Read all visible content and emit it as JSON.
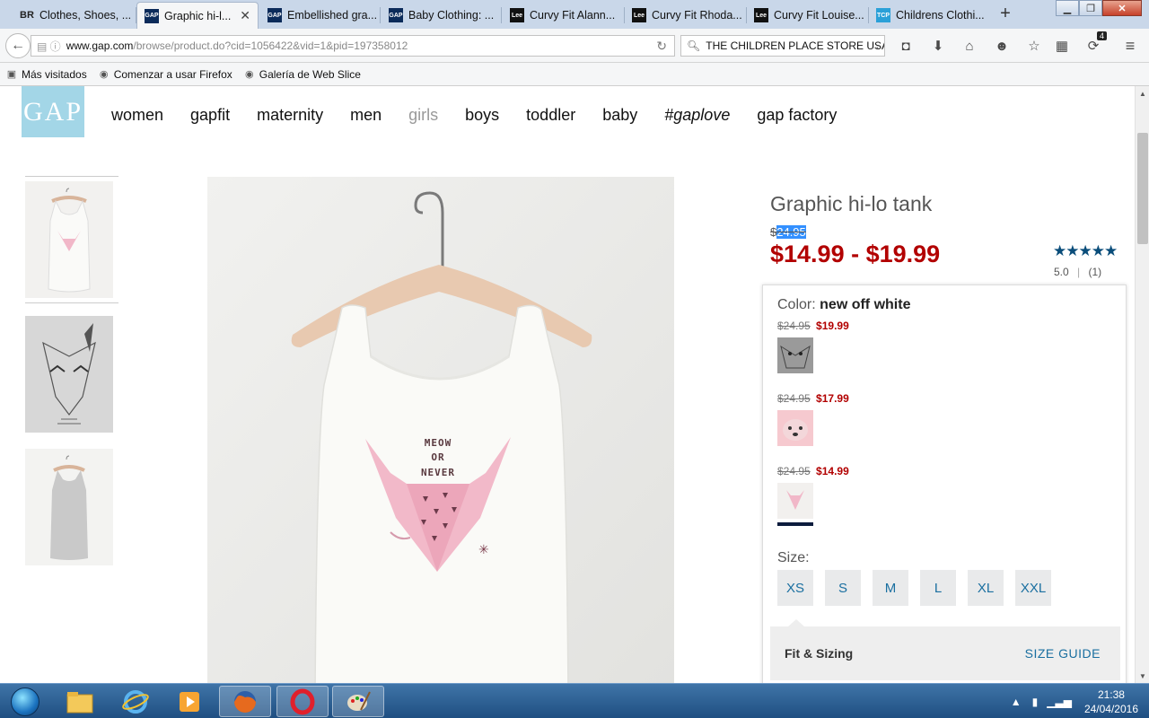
{
  "browser": {
    "tabs": [
      {
        "label": "Clothes, Shoes, ...",
        "favicon": "BR"
      },
      {
        "label": "Graphic hi-l...",
        "favicon": "GAP"
      },
      {
        "label": "Embellished gra...",
        "favicon": "GAP"
      },
      {
        "label": "Baby Clothing: ...",
        "favicon": "GAP"
      },
      {
        "label": "Curvy Fit Alann...",
        "favicon": "Lee"
      },
      {
        "label": "Curvy Fit Rhoda...",
        "favicon": "Lee"
      },
      {
        "label": "Curvy Fit Louise...",
        "favicon": "Lee"
      },
      {
        "label": "Childrens Clothi...",
        "favicon": "TCP"
      }
    ],
    "url_host": "www.gap.com",
    "url_path": "/browse/product.do?cid=1056422&vid=1&pid=197358012",
    "search_value": "THE CHILDREN PLACE  STORE USA",
    "badge_count": "4",
    "bookmarks": [
      "Más visitados",
      "Comenzar a usar Firefox",
      "Galería de Web Slice"
    ]
  },
  "site": {
    "logo": "GAP",
    "nav": [
      "women",
      "gapfit",
      "maternity",
      "men",
      "girls",
      "boys",
      "toddler",
      "baby",
      "#gaplove",
      "gap factory"
    ]
  },
  "product": {
    "title": "Graphic hi-lo tank",
    "orig_currency": "$",
    "orig_amount": "24.95",
    "price_range": "$14.99 - $19.99",
    "stars": "★★★★★",
    "rating": "5.0",
    "review_count": "(1)",
    "color_label": "Color:",
    "color_name": "new off white",
    "swatches": [
      {
        "was": "$24.95",
        "now": "$19.99"
      },
      {
        "was": "$24.95",
        "now": "$17.99"
      },
      {
        "was": "$24.95",
        "now": "$14.99"
      }
    ],
    "size_label": "Size:",
    "sizes": [
      "XS",
      "S",
      "M",
      "L",
      "XL",
      "XXL"
    ],
    "fit_title": "Fit & Sizing",
    "size_guide": "SIZE GUIDE",
    "shirt_text": [
      "MEOW",
      "OR",
      "NEVER"
    ]
  },
  "taskbar": {
    "time": "21:38",
    "date": "24/04/2016"
  },
  "colors": {
    "sale_red": "#b20000",
    "link_blue": "#1a6fa0",
    "logo_blue": "#a3d6e7",
    "star_blue": "#0a4d7a"
  }
}
